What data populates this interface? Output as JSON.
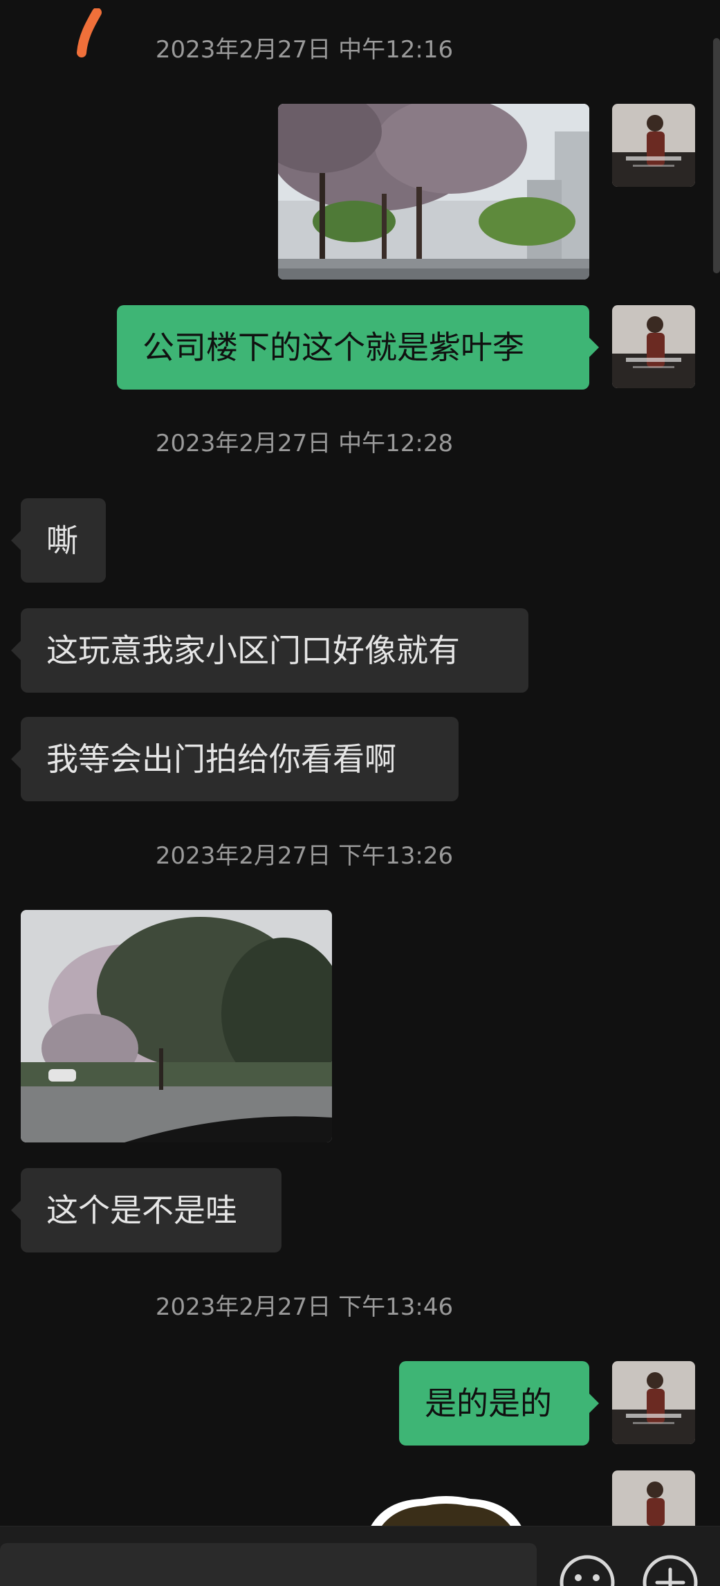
{
  "messages": {
    "ts1": "2023年2月27日 中午12:16",
    "ts2": "2023年2月27日 中午12:28",
    "ts3": "2023年2月27日 下午13:26",
    "ts4": "2023年2月27日 下午13:46",
    "sent1": "公司楼下的这个就是紫叶李",
    "recv1": "嘶",
    "recv2": "这玩意我家小区门口好像就有",
    "recv3": "我等会出门拍给你看看啊",
    "recv4": "这个是不是哇",
    "sent2": "是的是的"
  },
  "icons": {
    "emoji": "emoji-icon",
    "add": "plus-circle-icon"
  },
  "colors": {
    "background": "#111111",
    "sent_bubble": "#3eb575",
    "received_bubble": "#2c2c2c",
    "timestamp": "#9a9a9a"
  }
}
